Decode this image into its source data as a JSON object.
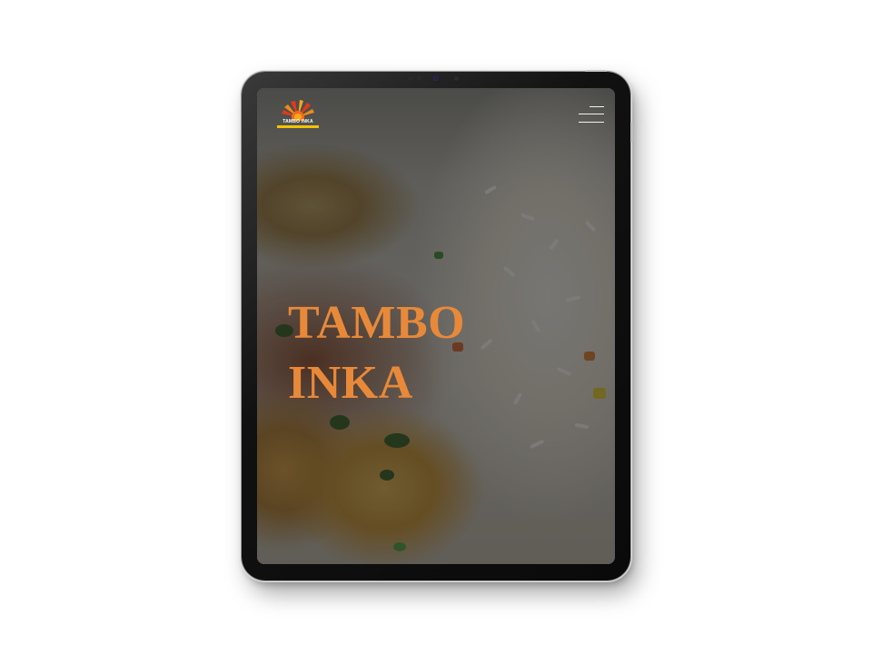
{
  "brand": {
    "logo_text": "TAMBO INKA",
    "accent_color": "#e8893a",
    "logo_bar_color": "#f2c300"
  },
  "nav": {
    "menu_icon": "hamburger-menu-icon"
  },
  "hero": {
    "title_line1": "TAMBO",
    "title_line2": "INKA",
    "background_image": "plated food with rice and fried potato croquettes"
  }
}
